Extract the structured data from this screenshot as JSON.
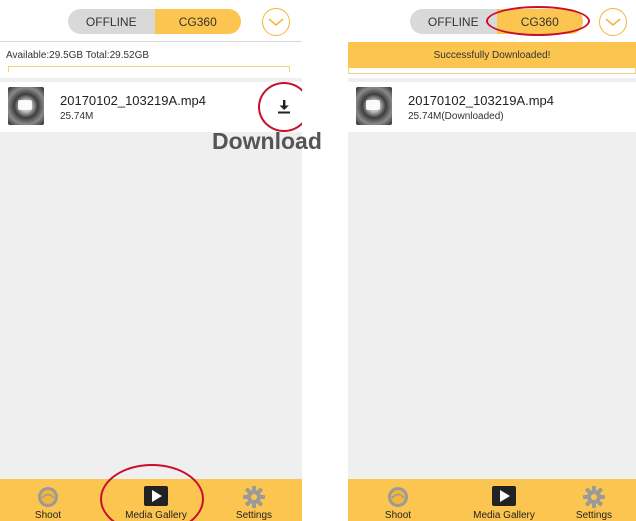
{
  "left_screen": {
    "header": {
      "tab_offline": "OFFLINE",
      "tab_camera": "CG360",
      "active_tab": "CG360"
    },
    "storage_text": "Available:29.5GB Total:29.52GB",
    "files": [
      {
        "name": "20170102_103219A.mp4",
        "size": "25.74M"
      }
    ],
    "annotation": "Download",
    "tabbar": {
      "shoot": "Shoot",
      "media_gallery": "Media Gallery",
      "settings": "Settings"
    }
  },
  "right_screen": {
    "header": {
      "tab_offline": "OFFLINE",
      "tab_camera": "CG360",
      "active_tab": "CG360"
    },
    "banner": "Successfully Downloaded!",
    "files": [
      {
        "name": "20170102_103219A.mp4",
        "size": "25.74M(Downloaded)"
      }
    ],
    "tabbar": {
      "shoot": "Shoot",
      "media_gallery": "Media Gallery",
      "settings": "Settings"
    }
  },
  "colors": {
    "accent": "#fcc54f",
    "highlight_ring": "#c8102e",
    "segment_inactive": "#d9d9d9",
    "list_background": "#efefef"
  },
  "icons": [
    "chevron-down-icon",
    "download-icon",
    "shoot-icon",
    "play-icon",
    "gear-icon",
    "video-thumbnail"
  ]
}
